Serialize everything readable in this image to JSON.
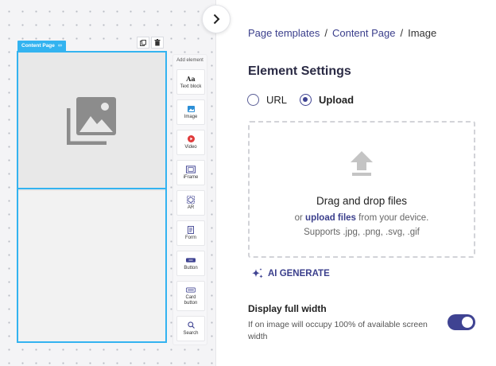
{
  "canvas": {
    "page_label": "Content Page",
    "palette": {
      "title": "Add element",
      "items": [
        {
          "label": "Text block",
          "icon": "text-aa-icon",
          "glyph": "Aa"
        },
        {
          "label": "Image",
          "icon": "image-icon"
        },
        {
          "label": "Video",
          "icon": "video-play-icon"
        },
        {
          "label": "iFrame",
          "icon": "iframe-icon"
        },
        {
          "label": "AR",
          "icon": "ar-icon"
        },
        {
          "label": "Form",
          "icon": "form-icon"
        },
        {
          "label": "Button",
          "icon": "button-icon"
        },
        {
          "label": "Card button",
          "icon": "card-button-icon"
        },
        {
          "label": "Search",
          "icon": "search-icon"
        }
      ]
    }
  },
  "breadcrumb": {
    "items": [
      "Page templates",
      "Content Page",
      "Image"
    ],
    "separator": "/"
  },
  "settings": {
    "title": "Element Settings",
    "source": {
      "options": [
        "URL",
        "Upload"
      ],
      "selected": "Upload"
    },
    "dropzone": {
      "title": "Drag and drop files",
      "line_prefix": "or ",
      "link": "upload files",
      "line_suffix": " from your device.",
      "supports": "Supports .jpg, .png, .svg, .gif"
    },
    "ai_generate": "AI GENERATE",
    "full_width": {
      "title": "Display full width",
      "description": "If on image will occupy 100% of available screen width",
      "enabled": true
    }
  },
  "colors": {
    "accent": "#3f4392",
    "selection": "#33b3f0",
    "placeholder_icon": "#8c8c8c"
  }
}
